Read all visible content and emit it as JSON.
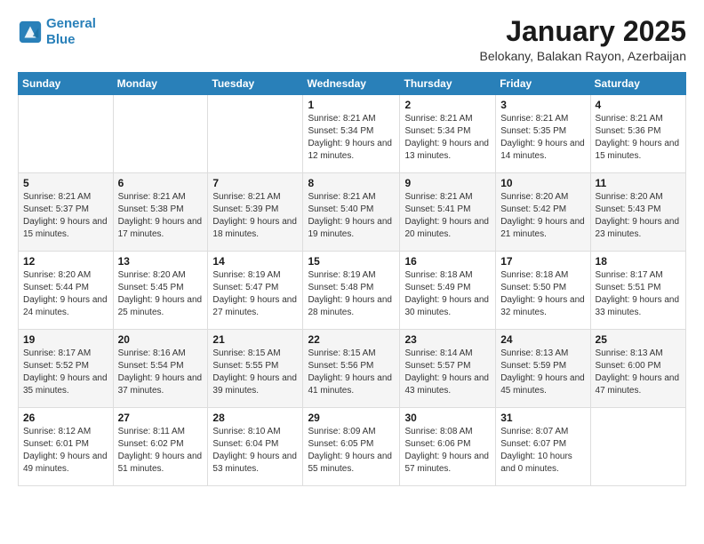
{
  "header": {
    "logo_line1": "General",
    "logo_line2": "Blue",
    "title": "January 2025",
    "subtitle": "Belokany, Balakan Rayon, Azerbaijan"
  },
  "weekdays": [
    "Sunday",
    "Monday",
    "Tuesday",
    "Wednesday",
    "Thursday",
    "Friday",
    "Saturday"
  ],
  "weeks": [
    [
      {
        "day": "",
        "sunrise": "",
        "sunset": "",
        "daylight": ""
      },
      {
        "day": "",
        "sunrise": "",
        "sunset": "",
        "daylight": ""
      },
      {
        "day": "",
        "sunrise": "",
        "sunset": "",
        "daylight": ""
      },
      {
        "day": "1",
        "sunrise": "Sunrise: 8:21 AM",
        "sunset": "Sunset: 5:34 PM",
        "daylight": "Daylight: 9 hours and 12 minutes."
      },
      {
        "day": "2",
        "sunrise": "Sunrise: 8:21 AM",
        "sunset": "Sunset: 5:34 PM",
        "daylight": "Daylight: 9 hours and 13 minutes."
      },
      {
        "day": "3",
        "sunrise": "Sunrise: 8:21 AM",
        "sunset": "Sunset: 5:35 PM",
        "daylight": "Daylight: 9 hours and 14 minutes."
      },
      {
        "day": "4",
        "sunrise": "Sunrise: 8:21 AM",
        "sunset": "Sunset: 5:36 PM",
        "daylight": "Daylight: 9 hours and 15 minutes."
      }
    ],
    [
      {
        "day": "5",
        "sunrise": "Sunrise: 8:21 AM",
        "sunset": "Sunset: 5:37 PM",
        "daylight": "Daylight: 9 hours and 15 minutes."
      },
      {
        "day": "6",
        "sunrise": "Sunrise: 8:21 AM",
        "sunset": "Sunset: 5:38 PM",
        "daylight": "Daylight: 9 hours and 17 minutes."
      },
      {
        "day": "7",
        "sunrise": "Sunrise: 8:21 AM",
        "sunset": "Sunset: 5:39 PM",
        "daylight": "Daylight: 9 hours and 18 minutes."
      },
      {
        "day": "8",
        "sunrise": "Sunrise: 8:21 AM",
        "sunset": "Sunset: 5:40 PM",
        "daylight": "Daylight: 9 hours and 19 minutes."
      },
      {
        "day": "9",
        "sunrise": "Sunrise: 8:21 AM",
        "sunset": "Sunset: 5:41 PM",
        "daylight": "Daylight: 9 hours and 20 minutes."
      },
      {
        "day": "10",
        "sunrise": "Sunrise: 8:20 AM",
        "sunset": "Sunset: 5:42 PM",
        "daylight": "Daylight: 9 hours and 21 minutes."
      },
      {
        "day": "11",
        "sunrise": "Sunrise: 8:20 AM",
        "sunset": "Sunset: 5:43 PM",
        "daylight": "Daylight: 9 hours and 23 minutes."
      }
    ],
    [
      {
        "day": "12",
        "sunrise": "Sunrise: 8:20 AM",
        "sunset": "Sunset: 5:44 PM",
        "daylight": "Daylight: 9 hours and 24 minutes."
      },
      {
        "day": "13",
        "sunrise": "Sunrise: 8:20 AM",
        "sunset": "Sunset: 5:45 PM",
        "daylight": "Daylight: 9 hours and 25 minutes."
      },
      {
        "day": "14",
        "sunrise": "Sunrise: 8:19 AM",
        "sunset": "Sunset: 5:47 PM",
        "daylight": "Daylight: 9 hours and 27 minutes."
      },
      {
        "day": "15",
        "sunrise": "Sunrise: 8:19 AM",
        "sunset": "Sunset: 5:48 PM",
        "daylight": "Daylight: 9 hours and 28 minutes."
      },
      {
        "day": "16",
        "sunrise": "Sunrise: 8:18 AM",
        "sunset": "Sunset: 5:49 PM",
        "daylight": "Daylight: 9 hours and 30 minutes."
      },
      {
        "day": "17",
        "sunrise": "Sunrise: 8:18 AM",
        "sunset": "Sunset: 5:50 PM",
        "daylight": "Daylight: 9 hours and 32 minutes."
      },
      {
        "day": "18",
        "sunrise": "Sunrise: 8:17 AM",
        "sunset": "Sunset: 5:51 PM",
        "daylight": "Daylight: 9 hours and 33 minutes."
      }
    ],
    [
      {
        "day": "19",
        "sunrise": "Sunrise: 8:17 AM",
        "sunset": "Sunset: 5:52 PM",
        "daylight": "Daylight: 9 hours and 35 minutes."
      },
      {
        "day": "20",
        "sunrise": "Sunrise: 8:16 AM",
        "sunset": "Sunset: 5:54 PM",
        "daylight": "Daylight: 9 hours and 37 minutes."
      },
      {
        "day": "21",
        "sunrise": "Sunrise: 8:15 AM",
        "sunset": "Sunset: 5:55 PM",
        "daylight": "Daylight: 9 hours and 39 minutes."
      },
      {
        "day": "22",
        "sunrise": "Sunrise: 8:15 AM",
        "sunset": "Sunset: 5:56 PM",
        "daylight": "Daylight: 9 hours and 41 minutes."
      },
      {
        "day": "23",
        "sunrise": "Sunrise: 8:14 AM",
        "sunset": "Sunset: 5:57 PM",
        "daylight": "Daylight: 9 hours and 43 minutes."
      },
      {
        "day": "24",
        "sunrise": "Sunrise: 8:13 AM",
        "sunset": "Sunset: 5:59 PM",
        "daylight": "Daylight: 9 hours and 45 minutes."
      },
      {
        "day": "25",
        "sunrise": "Sunrise: 8:13 AM",
        "sunset": "Sunset: 6:00 PM",
        "daylight": "Daylight: 9 hours and 47 minutes."
      }
    ],
    [
      {
        "day": "26",
        "sunrise": "Sunrise: 8:12 AM",
        "sunset": "Sunset: 6:01 PM",
        "daylight": "Daylight: 9 hours and 49 minutes."
      },
      {
        "day": "27",
        "sunrise": "Sunrise: 8:11 AM",
        "sunset": "Sunset: 6:02 PM",
        "daylight": "Daylight: 9 hours and 51 minutes."
      },
      {
        "day": "28",
        "sunrise": "Sunrise: 8:10 AM",
        "sunset": "Sunset: 6:04 PM",
        "daylight": "Daylight: 9 hours and 53 minutes."
      },
      {
        "day": "29",
        "sunrise": "Sunrise: 8:09 AM",
        "sunset": "Sunset: 6:05 PM",
        "daylight": "Daylight: 9 hours and 55 minutes."
      },
      {
        "day": "30",
        "sunrise": "Sunrise: 8:08 AM",
        "sunset": "Sunset: 6:06 PM",
        "daylight": "Daylight: 9 hours and 57 minutes."
      },
      {
        "day": "31",
        "sunrise": "Sunrise: 8:07 AM",
        "sunset": "Sunset: 6:07 PM",
        "daylight": "Daylight: 10 hours and 0 minutes."
      },
      {
        "day": "",
        "sunrise": "",
        "sunset": "",
        "daylight": ""
      }
    ]
  ]
}
